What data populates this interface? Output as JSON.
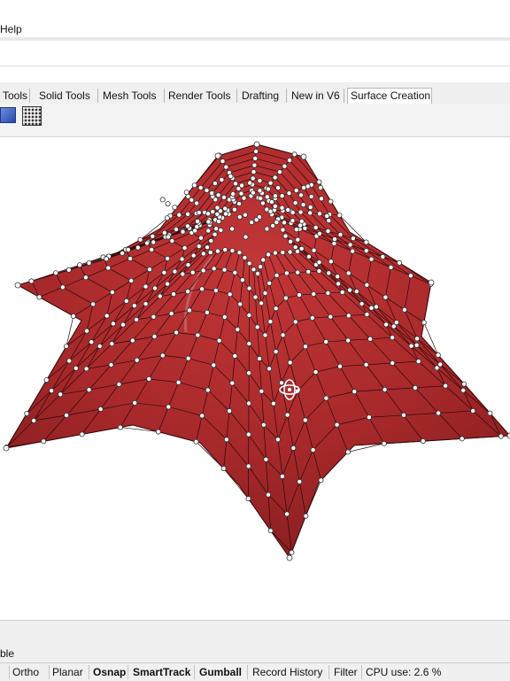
{
  "menubar": {
    "help_label": "Help"
  },
  "ribbon": {
    "tabs": [
      {
        "label": "Tools",
        "active": false
      },
      {
        "label": "Solid Tools",
        "active": false
      },
      {
        "label": "Mesh Tools",
        "active": false
      },
      {
        "label": "Render Tools",
        "active": false
      },
      {
        "label": "Drafting",
        "active": false
      },
      {
        "label": "New in V6",
        "active": false
      },
      {
        "label": "Surface Creation",
        "active": true
      }
    ],
    "icons": [
      "surface-tool-icon",
      "control-point-grid-icon"
    ]
  },
  "viewport": {
    "object": "tensile-surface-with-control-points",
    "surface_color": "#a8292b",
    "point_color": "#ffffff",
    "gumball_icon": "gumball-rotate-icon"
  },
  "command_line": {
    "text": "ble"
  },
  "statusbar": {
    "panes": [
      {
        "label": "Ortho",
        "bold": false
      },
      {
        "label": "Planar",
        "bold": false
      },
      {
        "label": "Osnap",
        "bold": true
      },
      {
        "label": "SmartTrack",
        "bold": true
      },
      {
        "label": "Gumball",
        "bold": true
      },
      {
        "label": "Record History",
        "bold": false
      },
      {
        "label": "Filter",
        "bold": false
      }
    ],
    "cpu_label": "CPU use: 2.6 %"
  }
}
